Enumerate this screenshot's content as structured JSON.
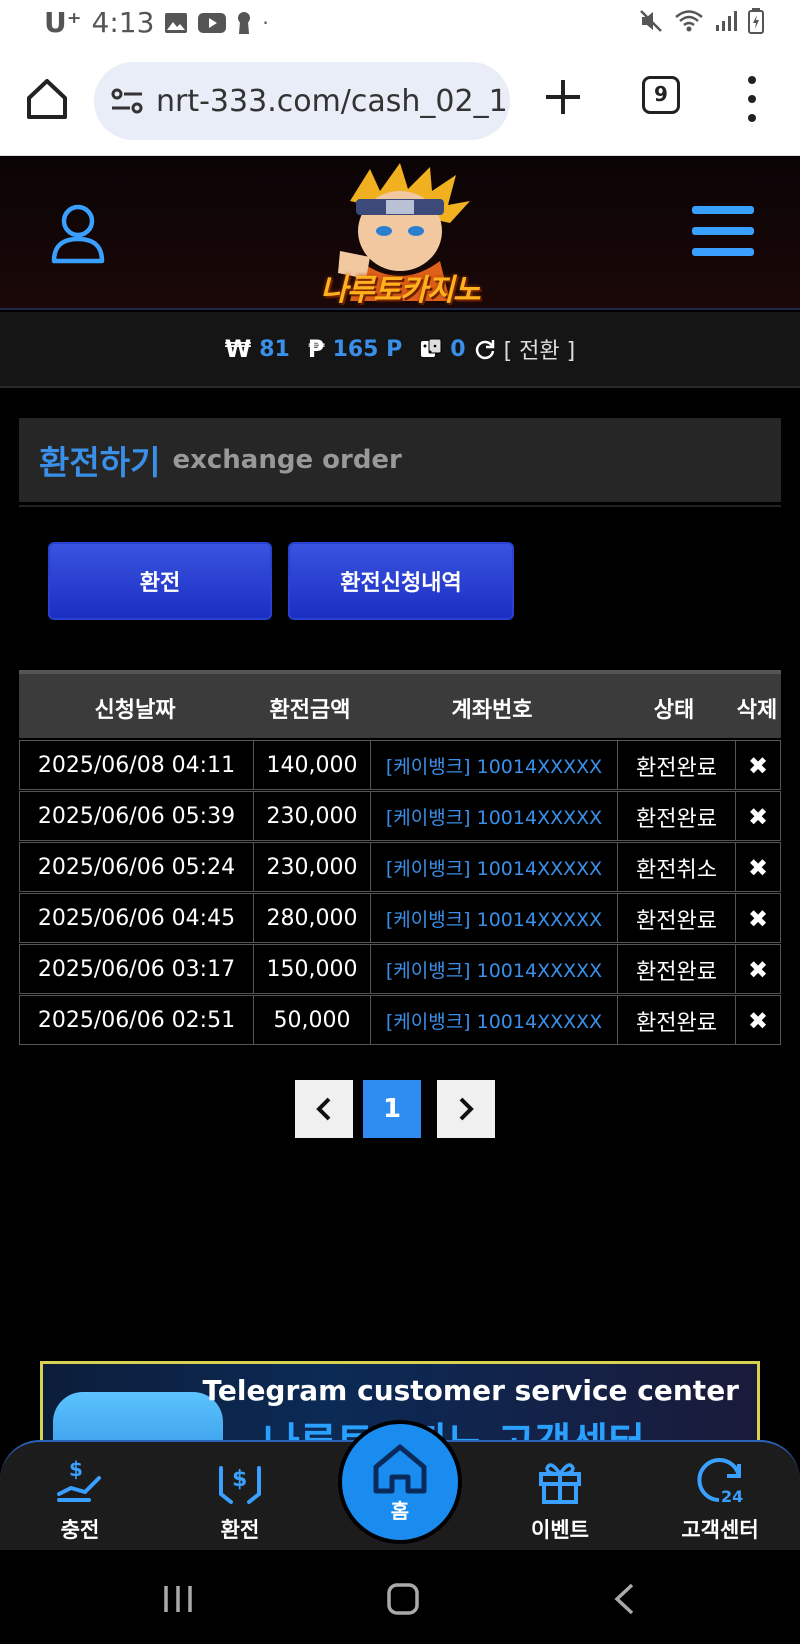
{
  "status": {
    "carrier": "U⁺",
    "time": "4:13"
  },
  "browser": {
    "url": "nrt-333.com/cash_02_1",
    "tab_count": "9"
  },
  "header": {
    "logo_text": "나루토카지노"
  },
  "balance": {
    "won_symbol": "₩",
    "won_value": "81",
    "point_symbol": "₱",
    "point_value": "165 P",
    "chip_value": "0",
    "convert_label": "[ 전환 ]"
  },
  "page": {
    "title_ko": "환전하기",
    "title_en": "exchange order"
  },
  "buttons": {
    "exchange": "환전",
    "history": "환전신청내역"
  },
  "table": {
    "headers": [
      "신청날짜",
      "환전금액",
      "계좌번호",
      "상태",
      "삭제"
    ],
    "rows": [
      {
        "date": "2025/06/08 04:11",
        "amount": "140,000",
        "account": "[케이뱅크] 10014XXXXX",
        "status": "환전완료",
        "delete": "✖"
      },
      {
        "date": "2025/06/06 05:39",
        "amount": "230,000",
        "account": "[케이뱅크] 10014XXXXX",
        "status": "환전완료",
        "delete": "✖"
      },
      {
        "date": "2025/06/06 05:24",
        "amount": "230,000",
        "account": "[케이뱅크] 10014XXXXX",
        "status": "환전취소",
        "delete": "✖"
      },
      {
        "date": "2025/06/06 04:45",
        "amount": "280,000",
        "account": "[케이뱅크] 10014XXXXX",
        "status": "환전완료",
        "delete": "✖"
      },
      {
        "date": "2025/06/06 03:17",
        "amount": "150,000",
        "account": "[케이뱅크] 10014XXXXX",
        "status": "환전완료",
        "delete": "✖"
      },
      {
        "date": "2025/06/06 02:51",
        "amount": "50,000",
        "account": "[케이뱅크] 10014XXXXX",
        "status": "환전완료",
        "delete": "✖"
      }
    ]
  },
  "pagination": {
    "prev": "‹",
    "current": "1",
    "next": "›"
  },
  "banner": {
    "text_en": "Telegram customer service center",
    "text_ko": "나루토카지노 고객센터"
  },
  "bottom_nav": {
    "charge": "충전",
    "exchange": "환전",
    "home": "홈",
    "event": "이벤트",
    "support": "고객센터"
  },
  "colors": {
    "accent": "#3a8fe8",
    "button_blue": "#2a40d0",
    "home_circle": "#1a8cf0"
  }
}
